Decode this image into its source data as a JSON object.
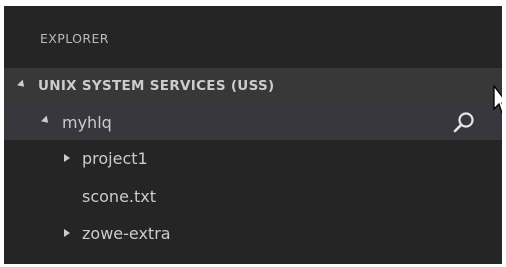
{
  "explorer": {
    "title": "EXPLORER"
  },
  "tree": {
    "section_label": "UNIX SYSTEM SERVICES (USS)",
    "profile_label": "myhlq",
    "items": [
      {
        "label": "project1",
        "type": "folder",
        "expanded": false
      },
      {
        "label": "scone.txt",
        "type": "file"
      },
      {
        "label": "zowe-extra",
        "type": "folder",
        "expanded": false
      }
    ]
  },
  "icons": {
    "section_twisty": "chevron-down-icon",
    "profile_action": "search-icon"
  },
  "colors": {
    "panel_bg": "#252526",
    "section_bg": "#383838",
    "selected_bg": "#37373d",
    "text": "#cccccc"
  }
}
